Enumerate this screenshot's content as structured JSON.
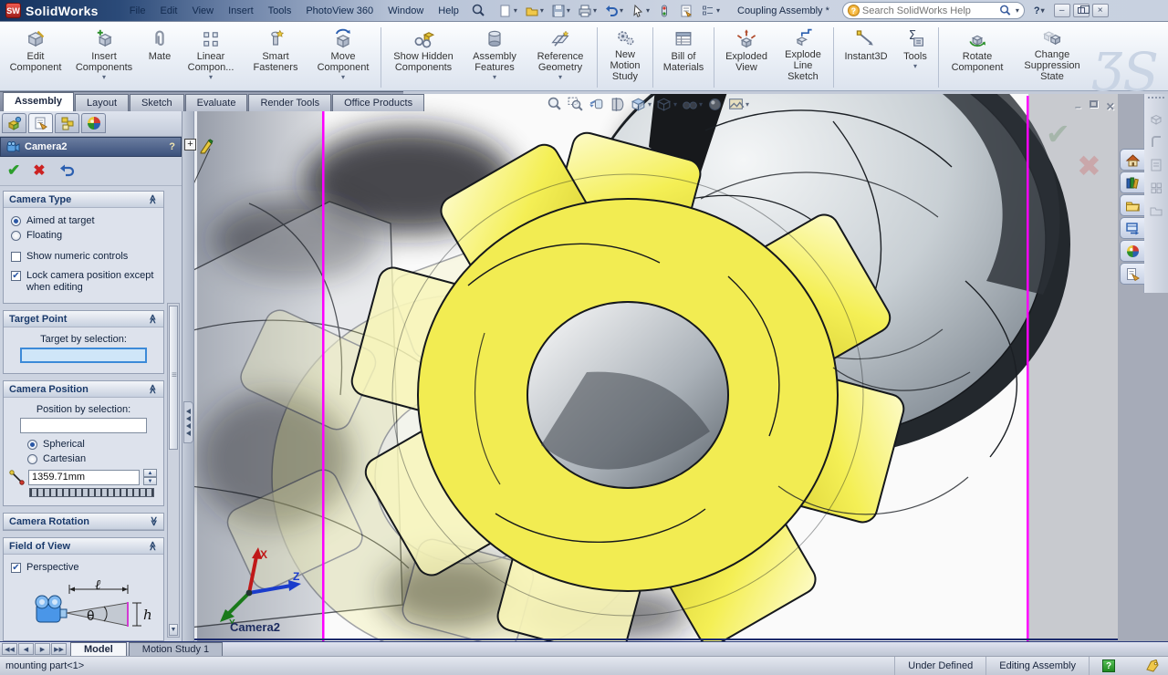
{
  "titlebar": {
    "app_name": "SolidWorks",
    "logo_abbr": "SW",
    "menus": [
      "File",
      "Edit",
      "View",
      "Insert",
      "Tools",
      "PhotoView 360",
      "Window",
      "Help"
    ],
    "document_title": "Coupling Assembly *",
    "search_placeholder": "Search SolidWorks Help"
  },
  "ribbon": {
    "buttons": [
      {
        "label": "Edit Component",
        "dropdown": false
      },
      {
        "label": "Insert Components",
        "dropdown": true
      },
      {
        "label": "Mate",
        "dropdown": false
      },
      {
        "label": "Linear Compon...",
        "dropdown": true
      },
      {
        "label": "Smart Fasteners",
        "dropdown": false
      },
      {
        "label": "Move Component",
        "dropdown": true
      },
      {
        "label": "Show Hidden Components",
        "dropdown": false
      },
      {
        "label": "Assembly Features",
        "dropdown": true
      },
      {
        "label": "Reference Geometry",
        "dropdown": true
      },
      {
        "label": "New Motion Study",
        "dropdown": false
      },
      {
        "label": "Bill of Materials",
        "dropdown": false
      },
      {
        "label": "Exploded View",
        "dropdown": false
      },
      {
        "label": "Explode Line Sketch",
        "dropdown": false
      },
      {
        "label": "Instant3D",
        "dropdown": false
      },
      {
        "label": "Tools",
        "dropdown": true
      },
      {
        "label": "Rotate Component",
        "dropdown": false
      },
      {
        "label": "Change Suppression State",
        "dropdown": false
      }
    ],
    "watermark": "ƷS"
  },
  "command_tabs": [
    "Assembly",
    "Layout",
    "Sketch",
    "Evaluate",
    "Render Tools",
    "Office Products"
  ],
  "property_panel": {
    "title": "Camera2",
    "help": "?",
    "camera_type": {
      "title": "Camera Type",
      "aimed": "Aimed at target",
      "floating": "Floating",
      "numeric": "Show numeric controls",
      "lock": "Lock camera position except when editing"
    },
    "target_point": {
      "title": "Target Point",
      "label": "Target by selection:"
    },
    "camera_position": {
      "title": "Camera Position",
      "label": "Position by selection:",
      "spherical": "Spherical",
      "cartesian": "Cartesian",
      "distance": "1359.71mm"
    },
    "camera_rotation": {
      "title": "Camera Rotation"
    },
    "field_of_view": {
      "title": "Field of View",
      "perspective": "Perspective",
      "dim_l": "ℓ",
      "dim_theta": "θ",
      "dim_h": "h"
    },
    "check_glyph": "✔"
  },
  "viewport": {
    "camera_label": "Camera2",
    "axis_x": "X",
    "axis_y": "Y",
    "axis_z": "Z"
  },
  "dock": {
    "tabs": [
      "Model",
      "Motion Study 1"
    ]
  },
  "statusbar": {
    "selection": "mounting part<1>",
    "state": "Under Defined",
    "mode": "Editing Assembly",
    "help_glyph": "?"
  },
  "colors": {
    "accent_magenta": "#ff00ff",
    "spider_yellow": "#f4ef55",
    "spring_red": "#cf2630"
  }
}
